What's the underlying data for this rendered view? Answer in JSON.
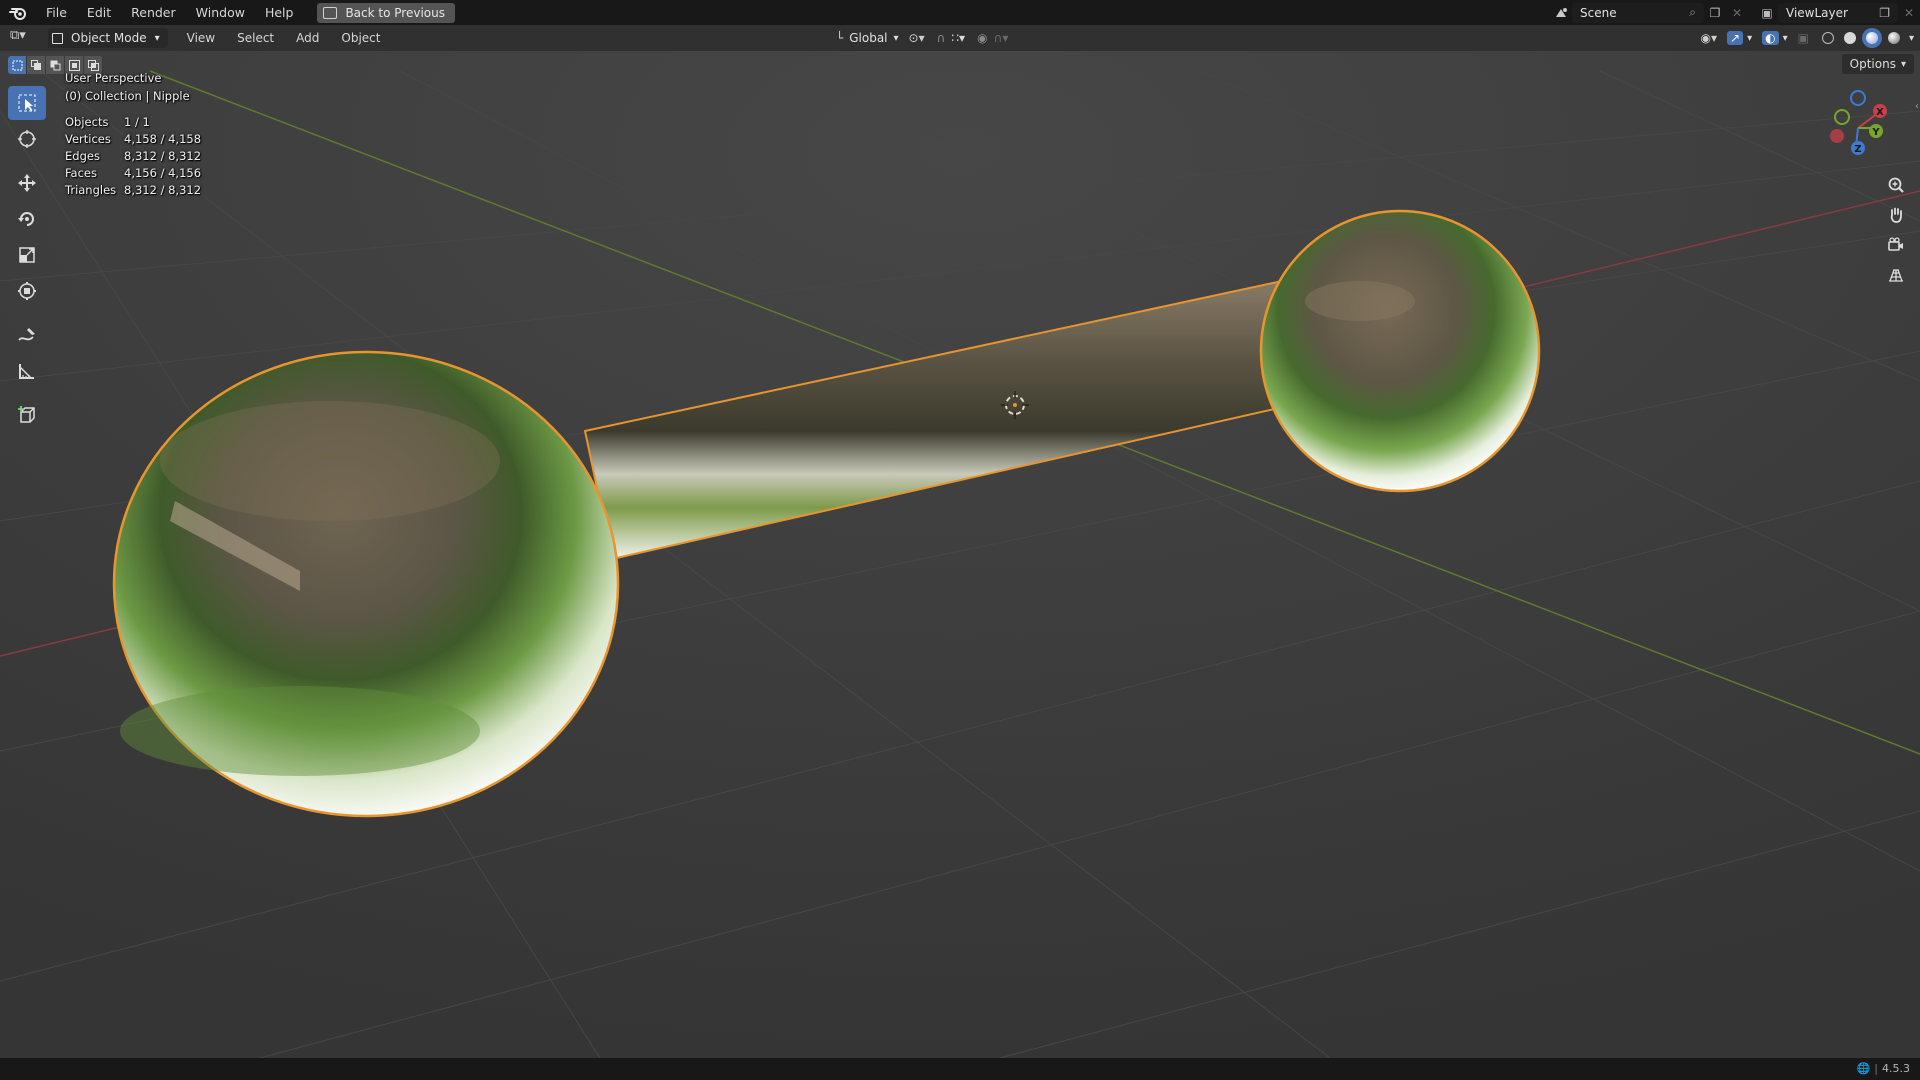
{
  "menubar": {
    "items": [
      "File",
      "Edit",
      "Render",
      "Window",
      "Help"
    ],
    "back_button": "Back to Previous",
    "scene": "Scene",
    "view_layer": "ViewLayer"
  },
  "header": {
    "mode": "Object Mode",
    "menus": [
      "View",
      "Select",
      "Add",
      "Object"
    ],
    "transform_orientation": "Global",
    "options_label": "Options"
  },
  "overlay": {
    "view_name": "User Perspective",
    "collection": "(0) Collection | Nipple",
    "stats": [
      {
        "label": "Objects",
        "value": "1 / 1"
      },
      {
        "label": "Vertices",
        "value": "4,158 / 4,158"
      },
      {
        "label": "Edges",
        "value": "8,312 / 8,312"
      },
      {
        "label": "Faces",
        "value": "4,156 / 4,156"
      },
      {
        "label": "Triangles",
        "value": "8,312 / 8,312"
      }
    ]
  },
  "gizmo": {
    "x_label": "X",
    "y_label": "Y",
    "z_label": "Z"
  },
  "statusbar": {
    "version": "4.5.3"
  },
  "colors": {
    "selection_outline": "#e6952f",
    "active_tool": "#4772b3",
    "axis_x": "#c8404a",
    "axis_y": "#7aa52c",
    "axis_z": "#3e7ad1"
  }
}
